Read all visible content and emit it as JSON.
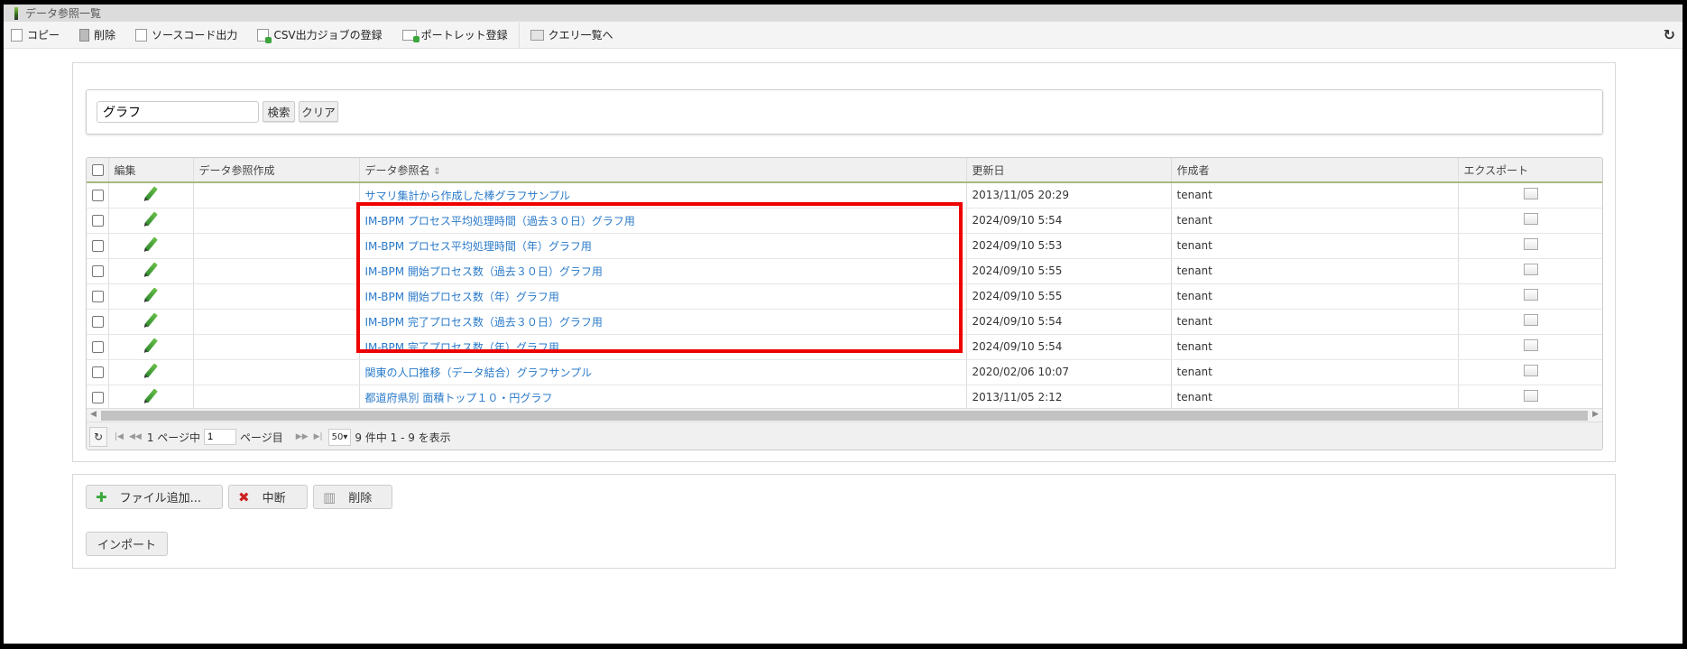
{
  "window": {
    "title": "データ参照一覧"
  },
  "toolbar": {
    "items": [
      {
        "label": "コピー",
        "icon": "copy-icon"
      },
      {
        "label": "削除",
        "icon": "trash-icon"
      },
      {
        "label": "ソースコード出力",
        "icon": "source-icon"
      },
      {
        "label": "CSV出力ジョブの登録",
        "icon": "csv-job-icon"
      },
      {
        "label": "ポートレット登録",
        "icon": "portlet-icon"
      },
      {
        "label": "クエリ一覧へ",
        "icon": "query-list-icon"
      }
    ],
    "refresh_icon": "↻"
  },
  "search": {
    "value": "グラフ",
    "search_label": "検索",
    "clear_label": "クリア"
  },
  "table": {
    "headers": [
      "編集",
      "データ参照作成",
      "データ参照名",
      "更新日",
      "作成者",
      "エクスポート"
    ],
    "sort_icon": "⇕",
    "rows": [
      {
        "name": "サマリ集計から作成した棒グラフサンプル",
        "updated": "2013/11/05 20:29",
        "author": "tenant"
      },
      {
        "name": "IM-BPM プロセス平均処理時間（過去３０日）グラフ用",
        "updated": "2024/09/10 5:54",
        "author": "tenant"
      },
      {
        "name": "IM-BPM プロセス平均処理時間（年）グラフ用",
        "updated": "2024/09/10 5:53",
        "author": "tenant"
      },
      {
        "name": "IM-BPM 開始プロセス数（過去３０日）グラフ用",
        "updated": "2024/09/10 5:55",
        "author": "tenant"
      },
      {
        "name": "IM-BPM 開始プロセス数（年）グラフ用",
        "updated": "2024/09/10 5:55",
        "author": "tenant"
      },
      {
        "name": "IM-BPM 完了プロセス数（過去３０日）グラフ用",
        "updated": "2024/09/10 5:54",
        "author": "tenant"
      },
      {
        "name": "IM-BPM 完了プロセス数（年）グラフ用",
        "updated": "2024/09/10 5:54",
        "author": "tenant"
      },
      {
        "name": "関東の人口推移（データ結合）グラフサンプル",
        "updated": "2020/02/06 10:07",
        "author": "tenant"
      },
      {
        "name": "都道府県別 面積トップ１０・円グラフ",
        "updated": "2013/11/05 2:12",
        "author": "tenant"
      }
    ]
  },
  "pager": {
    "page_prefix": "1 ページ中",
    "page_value": "1",
    "page_suffix": "ページ目",
    "page_size": "50",
    "summary": "9 件中 1 - 9 を表示"
  },
  "upload": {
    "add_label": "ファイル追加...",
    "abort_label": "中断",
    "delete_label": "削除",
    "import_label": "インポート"
  }
}
